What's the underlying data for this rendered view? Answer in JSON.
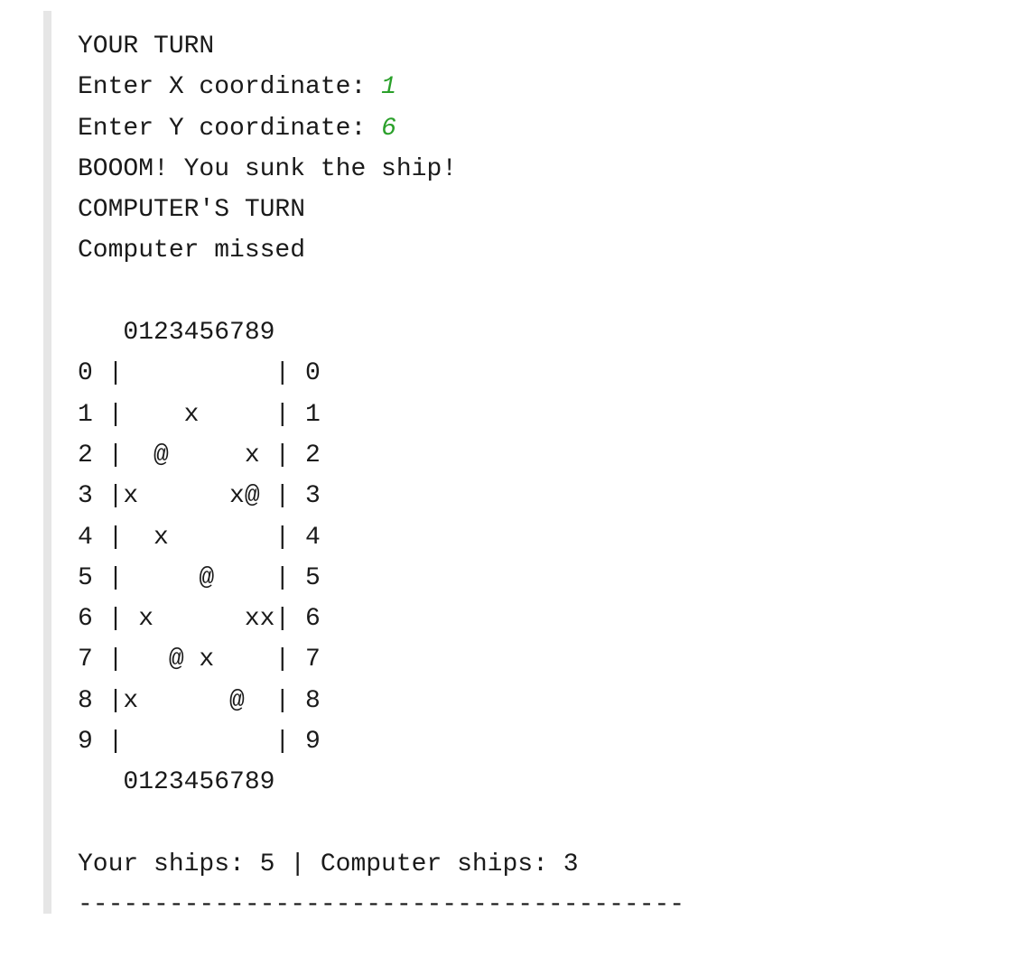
{
  "console": {
    "turn_header": "YOUR TURN",
    "x_prompt": "Enter X coordinate: ",
    "x_value": "1",
    "y_prompt": "Enter Y coordinate: ",
    "y_value": "6",
    "hit_message": "BOOOM! You sunk the ship!",
    "computer_turn_header": "COMPUTER'S TURN",
    "computer_result": "Computer missed",
    "board": {
      "column_header_top": "   0123456789",
      "rows": [
        "0 |          | 0",
        "1 |    x     | 1",
        "2 |  @     x | 2",
        "3 |x      x@ | 3",
        "4 |  x       | 4",
        "5 |     @    | 5",
        "6 | x      xx| 6",
        "7 |   @ x    | 7",
        "8 |x      @  | 8",
        "9 |          | 9"
      ],
      "column_header_bottom": "   0123456789"
    },
    "status_line": "Your ships: 5 | Computer ships: 3",
    "separator": "----------------------------------------"
  }
}
